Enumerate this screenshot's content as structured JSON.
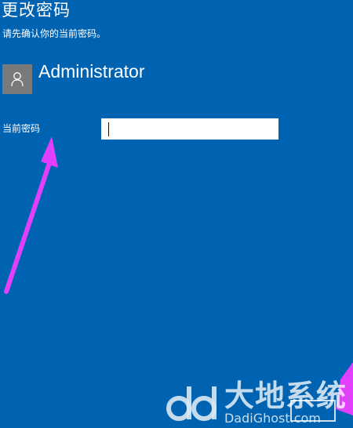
{
  "header": {
    "title": "更改密码",
    "subtitle": "请先确认你的当前密码。"
  },
  "account": {
    "name": "Administrator",
    "avatar_icon": "user-icon"
  },
  "form": {
    "current_password_label": "当前密码",
    "current_password_value": ""
  },
  "watermark": {
    "brand_cn": "大地系统",
    "brand_en": "DadiGhost.com"
  },
  "colors": {
    "background": "#0063b1",
    "avatar_bg": "#7a7a7a",
    "annotation_arrow": "#e040fb"
  }
}
